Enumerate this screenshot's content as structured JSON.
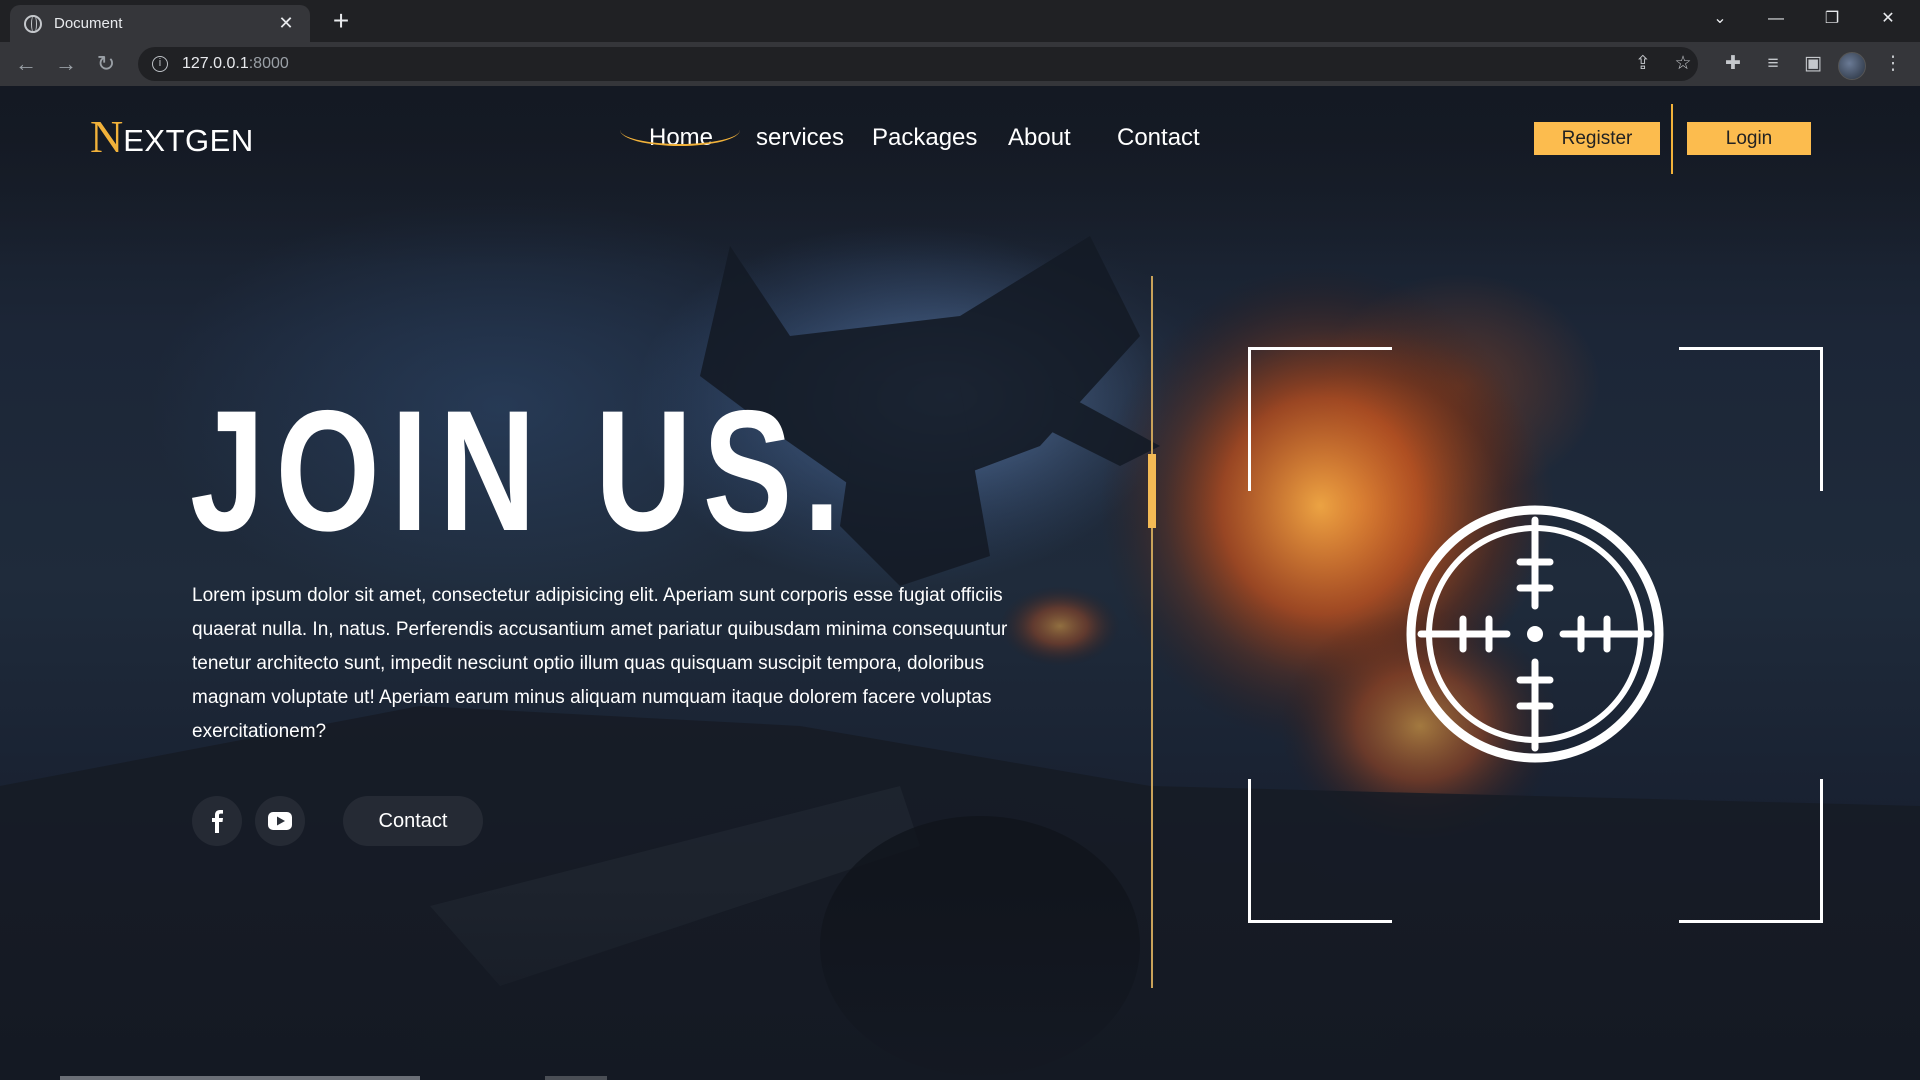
{
  "browser": {
    "tab_title": "Document",
    "url_host": "127.0.0.1",
    "url_port": ":8000"
  },
  "site": {
    "logo_first": "N",
    "logo_rest": "EXTGEN",
    "nav": [
      "Home",
      "services",
      "Packages",
      "About",
      "Contact"
    ],
    "active_nav": "Home",
    "register_label": "Register",
    "login_label": "Login"
  },
  "hero": {
    "title": "JOIN US.",
    "paragraph": "Lorem ipsum dolor sit amet, consectetur adipisicing elit. Aperiam sunt corporis esse fugiat officiis quaerat nulla. In, natus. Perferendis accusantium amet pariatur quibusdam minima consequuntur tenetur architecto sunt, impedit nesciunt optio illum quas quisquam suscipit tempora, doloribus magnam voluptate ut! Aperiam earum minus aliquam numquam itaque dolorem facere voluptas exercitationem?",
    "contact_label": "Contact"
  },
  "icons": {
    "social": [
      "facebook-icon",
      "youtube-icon"
    ],
    "graphic": "crosshair-icon"
  },
  "colors": {
    "accent": "#fcbc4e",
    "background": "#141923"
  }
}
